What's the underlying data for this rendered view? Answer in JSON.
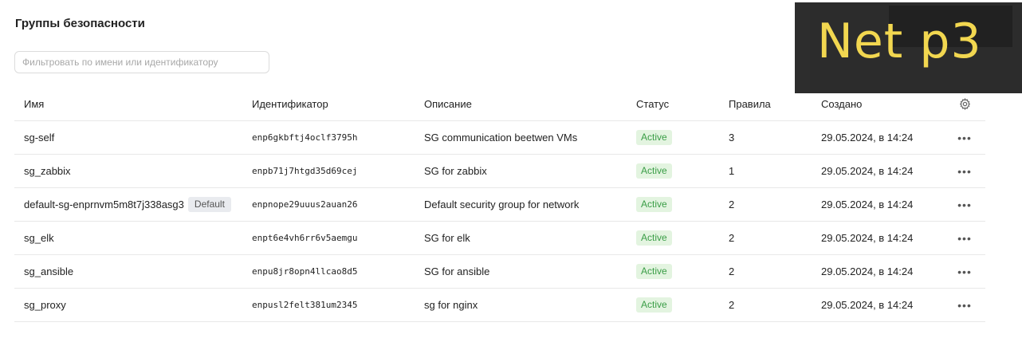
{
  "page": {
    "title": "Группы безопасности",
    "filter_placeholder": "Фильтровать по имени или идентификатору"
  },
  "table": {
    "columns": {
      "name": "Имя",
      "id": "Идентификатор",
      "description": "Описание",
      "status": "Статус",
      "rules": "Правила",
      "created": "Создано"
    },
    "settings_icon": "gear-icon",
    "actions_icon": "more-horizontal-icon",
    "rows": [
      {
        "name": "sg-self",
        "badge": "",
        "id": "enp6gkbftj4oclf3795h",
        "description": "SG communication beetwen VMs",
        "status": "Active",
        "rules": "3",
        "created": "29.05.2024, в 14:24"
      },
      {
        "name": "sg_zabbix",
        "badge": "",
        "id": "enpb71j7htgd35d69cej",
        "description": "SG for zabbix",
        "status": "Active",
        "rules": "1",
        "created": "29.05.2024, в 14:24"
      },
      {
        "name": "default-sg-enprnvm5m8t7j338asg3",
        "badge": "Default",
        "id": "enpnope29uuus2auan26",
        "description": "Default security group for network",
        "status": "Active",
        "rules": "2",
        "created": "29.05.2024, в 14:24"
      },
      {
        "name": "sg_elk",
        "badge": "",
        "id": "enpt6e4vh6rr6v5aemgu",
        "description": "SG for elk",
        "status": "Active",
        "rules": "2",
        "created": "29.05.2024, в 14:24"
      },
      {
        "name": "sg_ansible",
        "badge": "",
        "id": "enpu8jr8opn4llcao8d5",
        "description": "SG for ansible",
        "status": "Active",
        "rules": "2",
        "created": "29.05.2024, в 14:24"
      },
      {
        "name": "sg_proxy",
        "badge": "",
        "id": "enpusl2felt381um2345",
        "description": "sg for nginx",
        "status": "Active",
        "rules": "2",
        "created": "29.05.2024, в 14:24"
      }
    ]
  },
  "overlay": {
    "text": "Net p3"
  },
  "colors": {
    "active_bg": "#e3f4e0",
    "active_text": "#3a9d46",
    "default_badge_bg": "#e9ebef",
    "overlay_text": "#f2d64b",
    "overlay_bg": "#262626"
  }
}
